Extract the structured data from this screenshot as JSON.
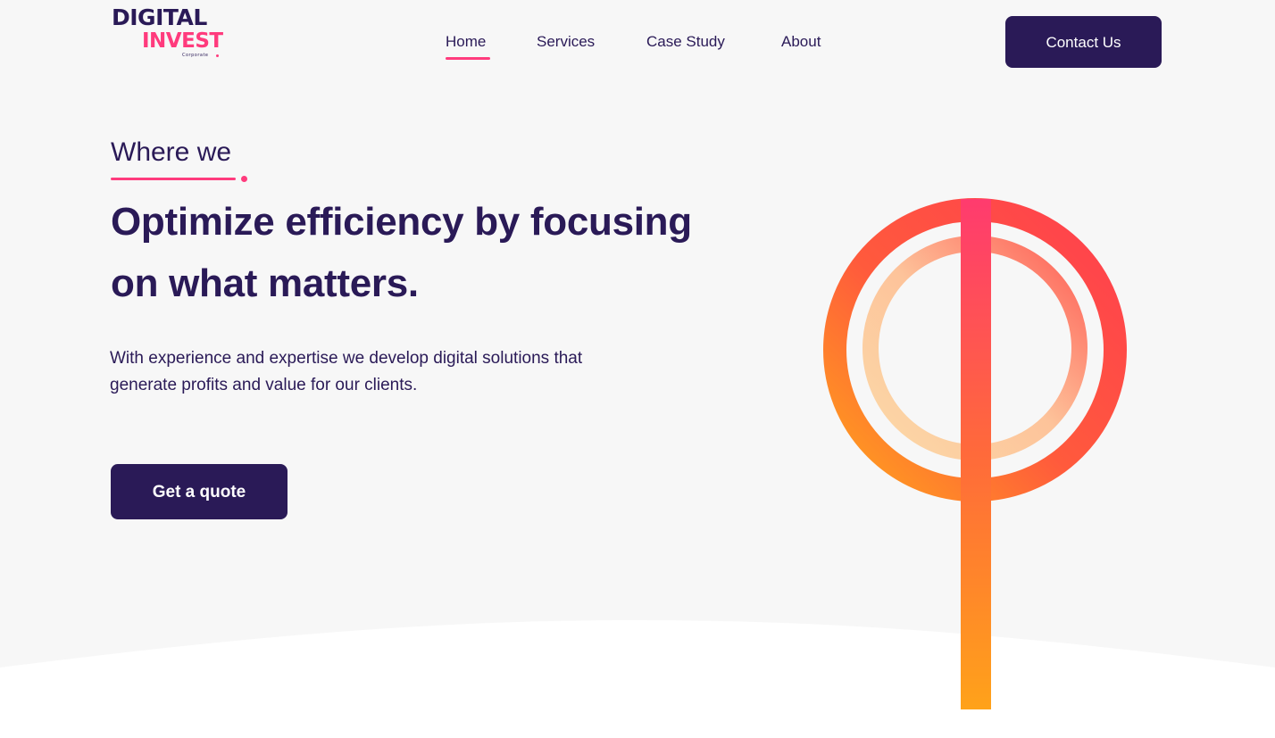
{
  "colors": {
    "primary": "#2a1a57",
    "accent": "#ff3b7d",
    "background": "#f7f7f7",
    "wave": "#ffffff",
    "gradient_orange": "#ff9f1a",
    "gradient_red": "#ff4a4a"
  },
  "brand": {
    "line1": "DIGITAL",
    "line2": "INVEST",
    "tagline": "Corporate"
  },
  "nav": {
    "items": [
      {
        "label": "Home",
        "active": true
      },
      {
        "label": "Services",
        "active": false
      },
      {
        "label": "Case Study",
        "active": false
      },
      {
        "label": "About",
        "active": false
      }
    ],
    "cta_label": "Contact Us"
  },
  "hero": {
    "eyebrow": "Where we",
    "headline": "Optimize efficiency by focusing on what matters.",
    "subtext": "With experience and expertise we develop digital solutions that generate profits and value for our clients.",
    "cta_label": "Get a quote"
  },
  "icons": {
    "hero_graphic": "phi-symbol-illustration-icon"
  }
}
